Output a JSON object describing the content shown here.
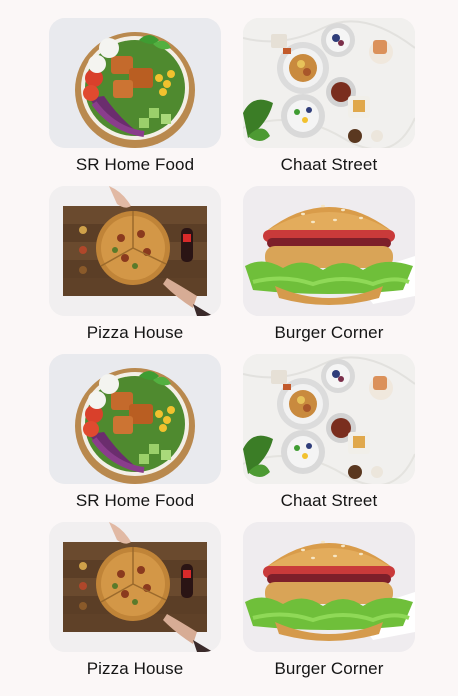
{
  "restaurants": [
    {
      "name": "SR Home Food",
      "image": "salad-bowl-image"
    },
    {
      "name": "Chaat Street",
      "image": "chaat-platter-image"
    },
    {
      "name": "Pizza House",
      "image": "pizza-board-image"
    },
    {
      "name": "Burger Corner",
      "image": "burger-image"
    },
    {
      "name": "SR Home Food",
      "image": "salad-bowl-image"
    },
    {
      "name": "Chaat Street",
      "image": "chaat-platter-image"
    },
    {
      "name": "Pizza House",
      "image": "pizza-board-image"
    },
    {
      "name": "Burger Corner",
      "image": "burger-image"
    }
  ]
}
